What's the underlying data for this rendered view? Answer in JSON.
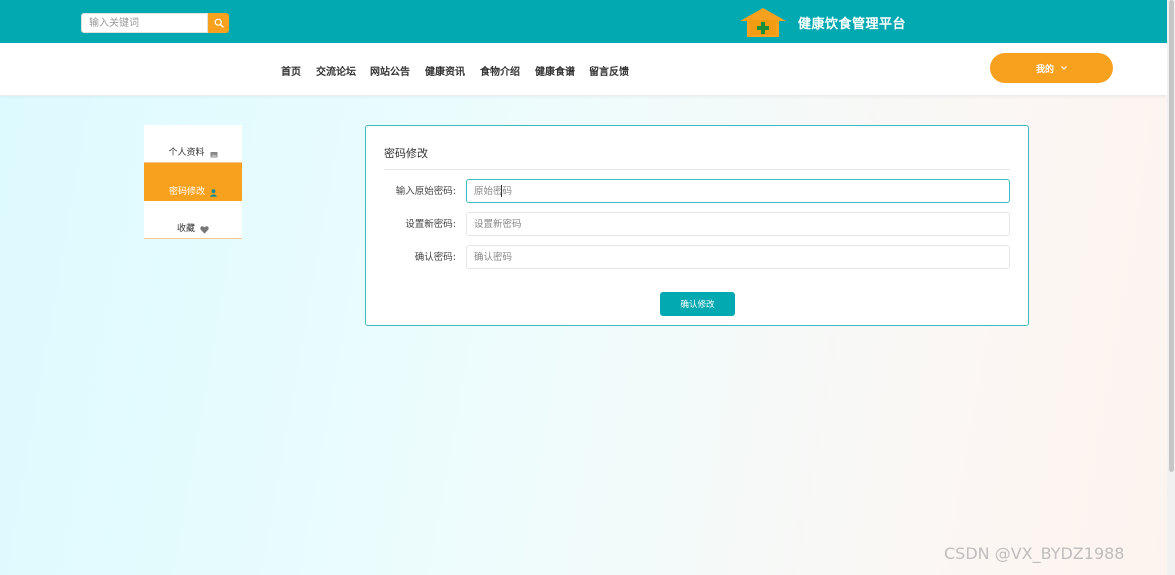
{
  "header": {
    "search_placeholder": "输入关键词",
    "site_title": "健康饮食管理平台",
    "search_icon": "search-icon",
    "logo_icon": "house-plus-icon"
  },
  "nav": {
    "items": [
      {
        "label": "首页"
      },
      {
        "label": "交流论坛"
      },
      {
        "label": "网站公告"
      },
      {
        "label": "健康资讯"
      },
      {
        "label": "食物介绍"
      },
      {
        "label": "健康食谱"
      },
      {
        "label": "留言反馈"
      }
    ],
    "my_label": "我的",
    "my_icon": "chevron-down-icon"
  },
  "sidebar": {
    "items": [
      {
        "label": "个人资料",
        "icon": "image-icon",
        "active": false
      },
      {
        "label": "密码修改",
        "icon": "user-icon",
        "active": true
      },
      {
        "label": "收藏",
        "icon": "heart-icon",
        "active": false
      }
    ]
  },
  "form": {
    "title": "密码修改",
    "fields": [
      {
        "label": "输入原始密码:",
        "placeholder": "原始密码",
        "value": ""
      },
      {
        "label": "设置新密码:",
        "placeholder": "设置新密码",
        "value": ""
      },
      {
        "label": "确认密码:",
        "placeholder": "确认密码",
        "value": ""
      }
    ],
    "submit_label": "确认修改"
  },
  "watermark": "CSDN @VX_BYDZ1988",
  "colors": {
    "primary": "#03a9b0",
    "accent": "#f7a11f"
  }
}
